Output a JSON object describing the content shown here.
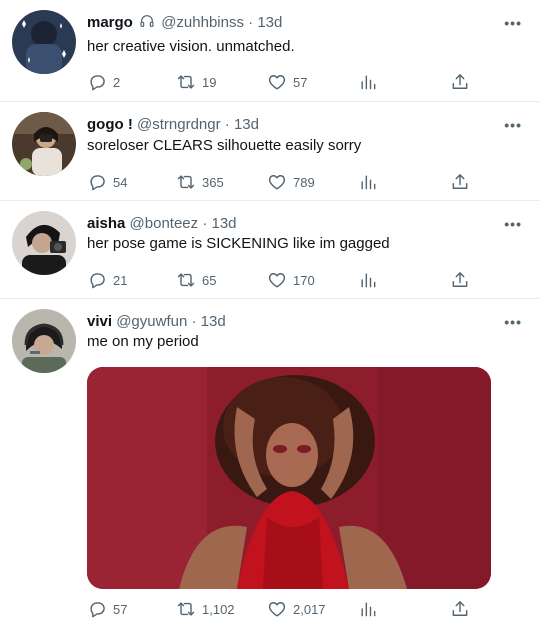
{
  "tweets": [
    {
      "name": "margo",
      "handle": "@zuhhbinss",
      "time": "13d",
      "text": "her creative vision. unmatched.",
      "replies": "2",
      "retweets": "19",
      "likes": "57",
      "has_headphones_icon": true
    },
    {
      "name": "gogo !",
      "handle": "@strngrdngr",
      "time": "13d",
      "text": "soreloser CLEARS silhouette easily sorry",
      "replies": "54",
      "retweets": "365",
      "likes": "789"
    },
    {
      "name": "aisha",
      "handle": "@bonteez",
      "time": "13d",
      "text": "her pose game is SICKENING like im gagged",
      "replies": "21",
      "retweets": "65",
      "likes": "170"
    },
    {
      "name": "vivi",
      "handle": "@gyuwfun",
      "time": "13d",
      "text": "me on my period",
      "replies": "57",
      "retweets": "1,102",
      "likes": "2,017",
      "has_media": true
    }
  ],
  "separator": "·",
  "more_label": "•••",
  "icons": [
    "reply-icon",
    "retweet-icon",
    "like-icon",
    "stats-icon",
    "share-icon",
    "more-icon",
    "headphones-icon"
  ],
  "colors": {
    "text": "#0f1419",
    "secondary": "#536471",
    "divider": "#e6ecf0",
    "media_bg": "#8e1d2c"
  }
}
